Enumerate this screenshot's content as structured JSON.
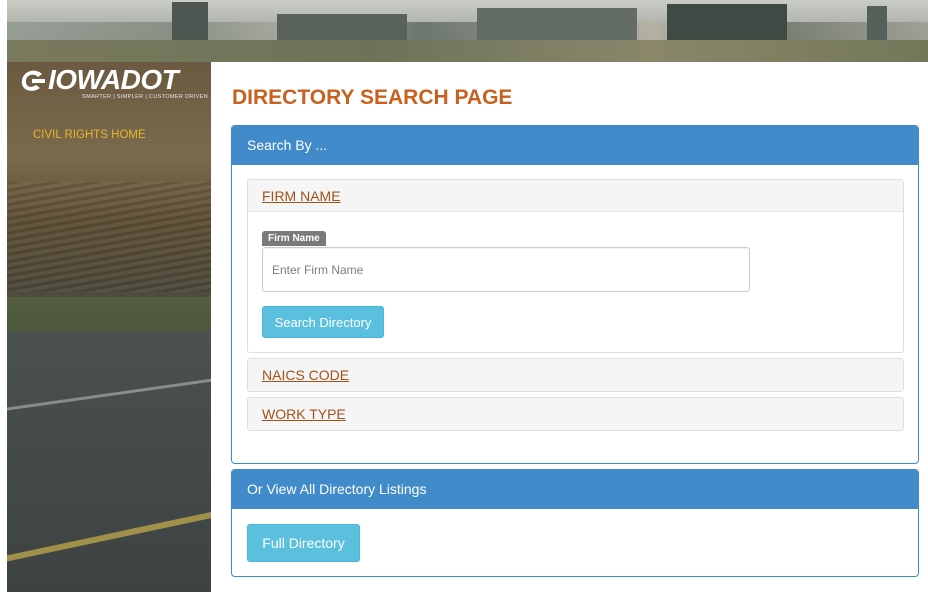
{
  "brand": {
    "logo_text": "IOWADOT",
    "tagline": "SMARTER | SIMPLER | CUSTOMER DRIVEN",
    "logo_icon": "iowadot-swoosh-icon",
    "accent_color": "#c8601f"
  },
  "sidebar": {
    "nav_link": "CIVIL RIGHTS HOME"
  },
  "main": {
    "title": "DIRECTORY SEARCH PAGE",
    "search_panel": {
      "heading": "Search By ...",
      "sections": [
        {
          "label": "FIRM NAME",
          "expanded": true,
          "field_label": "Firm Name",
          "input_value": "",
          "input_placeholder": "Enter Firm Name",
          "button_label": "Search Directory"
        },
        {
          "label": "NAICS CODE",
          "expanded": false
        },
        {
          "label": "WORK TYPE",
          "expanded": false
        }
      ]
    },
    "listings_panel": {
      "heading": "Or View All Directory Listings",
      "button_label": "Full Directory"
    }
  },
  "colors": {
    "panel_heading": "#428bca",
    "button_info": "#5bc0de",
    "link": "#a0531b",
    "nav_link": "#e8b62a"
  }
}
